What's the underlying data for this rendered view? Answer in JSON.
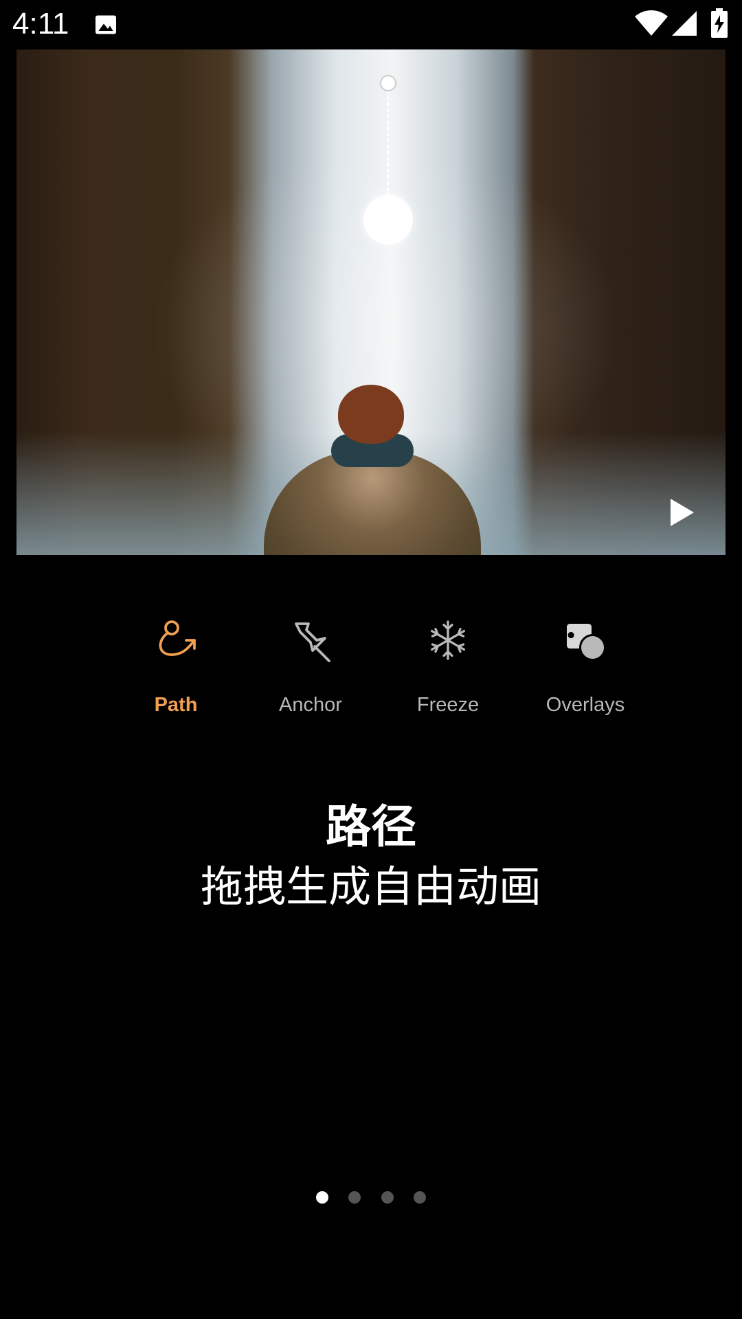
{
  "status_bar": {
    "time": "4:11",
    "icons": [
      "gallery-icon",
      "wifi-icon",
      "signal-icon",
      "battery-charging-icon"
    ]
  },
  "preview": {
    "description_icons": [
      "drag-path-handle",
      "play-icon"
    ]
  },
  "tools": [
    {
      "label": "Path",
      "icon": "path-icon",
      "active": true
    },
    {
      "label": "Anchor",
      "icon": "pin-icon",
      "active": false
    },
    {
      "label": "Freeze",
      "icon": "snowflake-icon",
      "active": false
    },
    {
      "label": "Overlays",
      "icon": "overlays-icon",
      "active": false
    }
  ],
  "caption": {
    "title": "路径",
    "subtitle": "拖拽生成自由动画"
  },
  "pager": {
    "count": 4,
    "active_index": 0
  },
  "colors": {
    "accent": "#f0a050",
    "inactive": "#b9b9b9",
    "background": "#000000"
  }
}
